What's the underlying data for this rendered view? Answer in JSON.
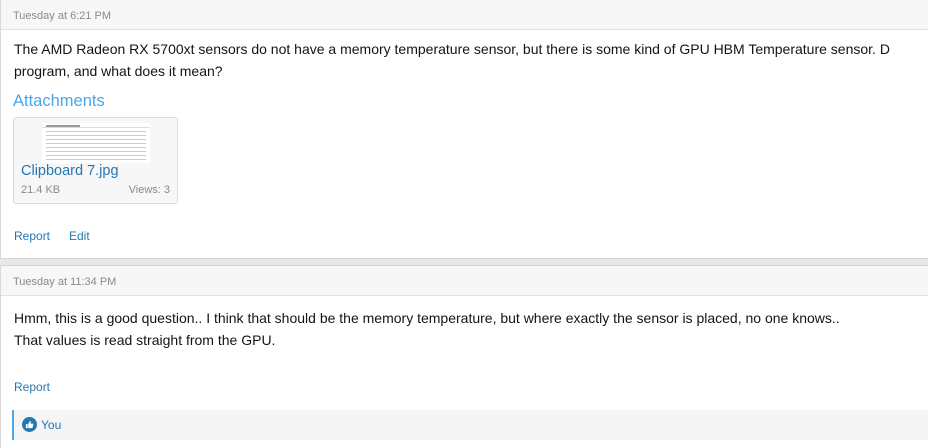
{
  "posts": [
    {
      "timestamp": "Tuesday at 6:21 PM",
      "lines": [
        "The AMD Radeon RX 5700xt sensors do not have a memory temperature sensor, but there is some kind of GPU HBM Temperature sensor. D",
        "program, and what does it mean?"
      ],
      "attachments_label": "Attachments",
      "attachment": {
        "file_name": "Clipboard 7.jpg",
        "size": "21.4 KB",
        "views": "Views: 3"
      },
      "actions": [
        "Report",
        "Edit"
      ]
    },
    {
      "timestamp": "Tuesday at 11:34 PM",
      "lines": [
        "Hmm, this is a good question.. I think that should be the memory temperature, but where exactly the sensor is placed, no one knows..",
        "That values is read straight from the GPU."
      ],
      "actions": [
        "Report"
      ],
      "reactions": {
        "icon": "like-icon",
        "users": "You"
      }
    }
  ],
  "colors": {
    "link": "#2577b1",
    "accent": "#47a7eb",
    "muted": "#8a8a8a"
  }
}
